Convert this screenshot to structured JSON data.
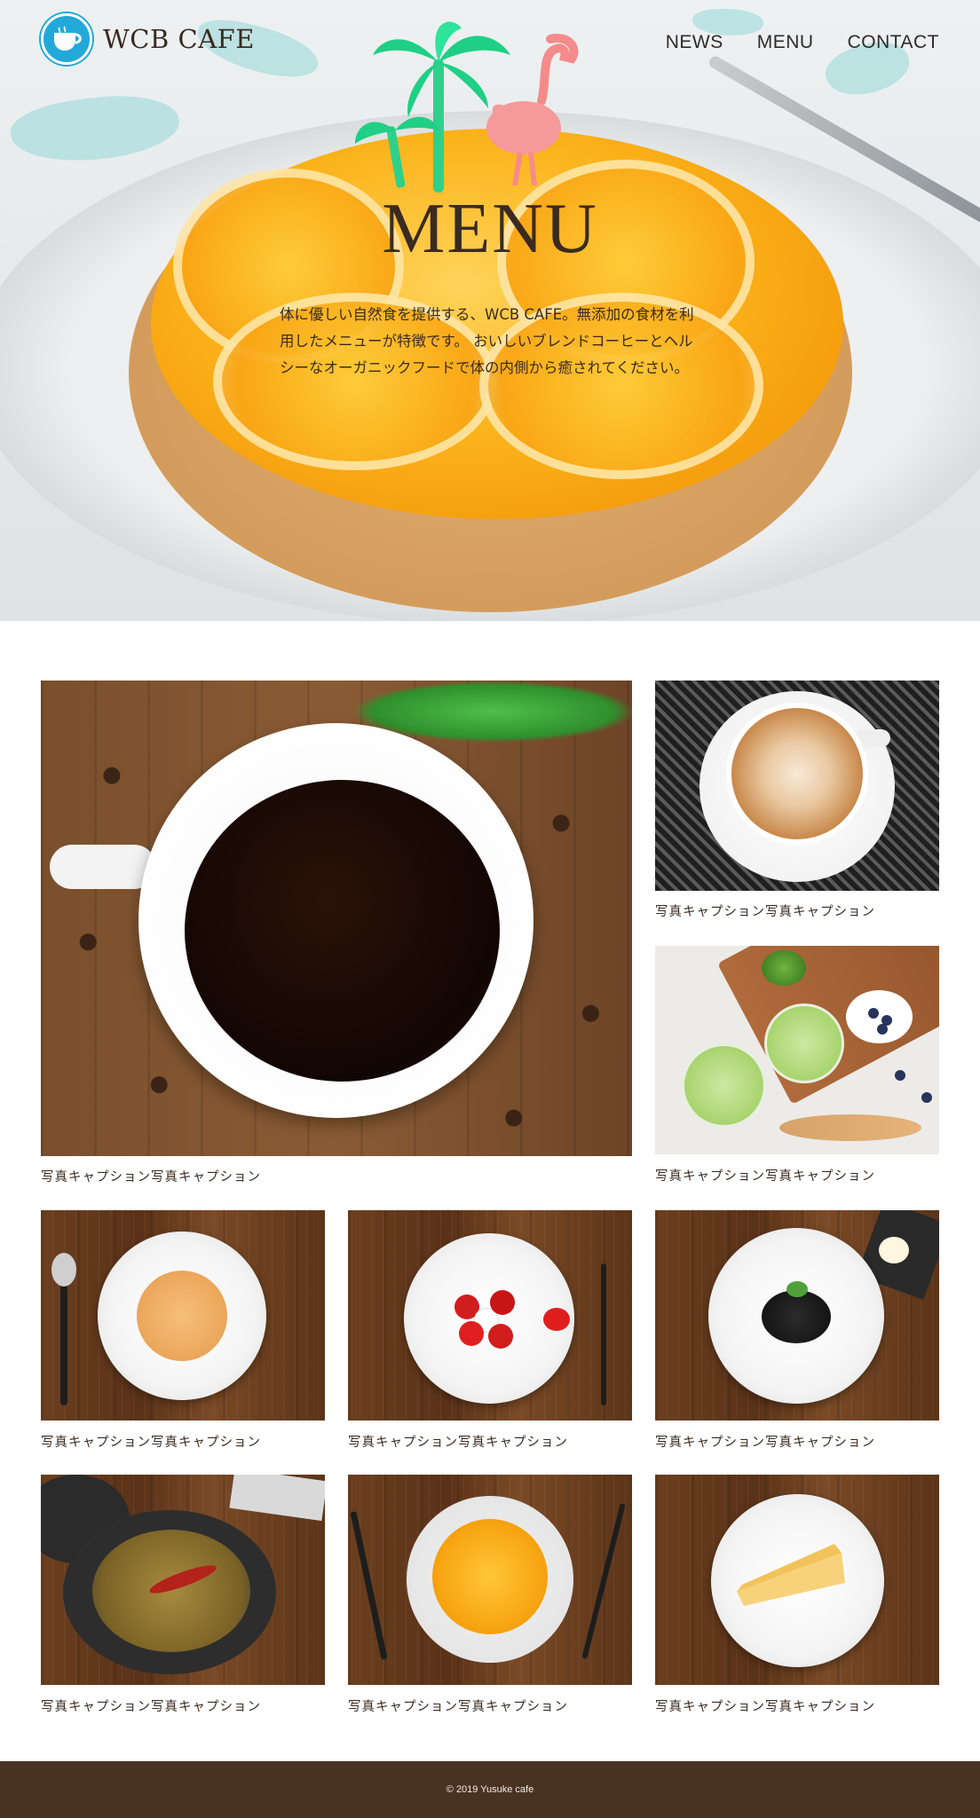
{
  "brand": {
    "name": "WCB CAFE",
    "logo_color": "#22a9d9"
  },
  "nav": {
    "items": [
      {
        "label": "NEWS"
      },
      {
        "label": "MENU"
      },
      {
        "label": "CONTACT"
      }
    ]
  },
  "hero": {
    "title": "MENU",
    "copy": "体に優しい自然食を提供する、WCB CAFE。無添加の食材を利用したメニューが特徴です。 おいしいブレンドコーヒーとヘルシーなオーガニックフードで体の内側から癒されてください。"
  },
  "gallery": {
    "items": [
      {
        "caption": "写真キャプション写真キャプション",
        "icon": "black-coffee-photo"
      },
      {
        "caption": "写真キャプション写真キャプション",
        "icon": "latte-art-photo"
      },
      {
        "caption": "写真キャプション写真キャプション",
        "icon": "green-smoothie-photo"
      },
      {
        "caption": "写真キャプション写真キャプション",
        "icon": "soup-photo"
      },
      {
        "caption": "写真キャプション写真キャプション",
        "icon": "caprese-salad-photo"
      },
      {
        "caption": "写真キャプション写真キャプション",
        "icon": "squid-ink-pasta-photo"
      },
      {
        "caption": "写真キャプション写真キャプション",
        "icon": "ajillo-pot-photo"
      },
      {
        "caption": "写真キャプション写真キャプション",
        "icon": "orange-tart-photo"
      },
      {
        "caption": "写真キャプション写真キャプション",
        "icon": "cheesecake-photo"
      }
    ]
  },
  "footer": {
    "copyright": "© 2019 Yusuke cafe",
    "background": "#4a3223"
  }
}
